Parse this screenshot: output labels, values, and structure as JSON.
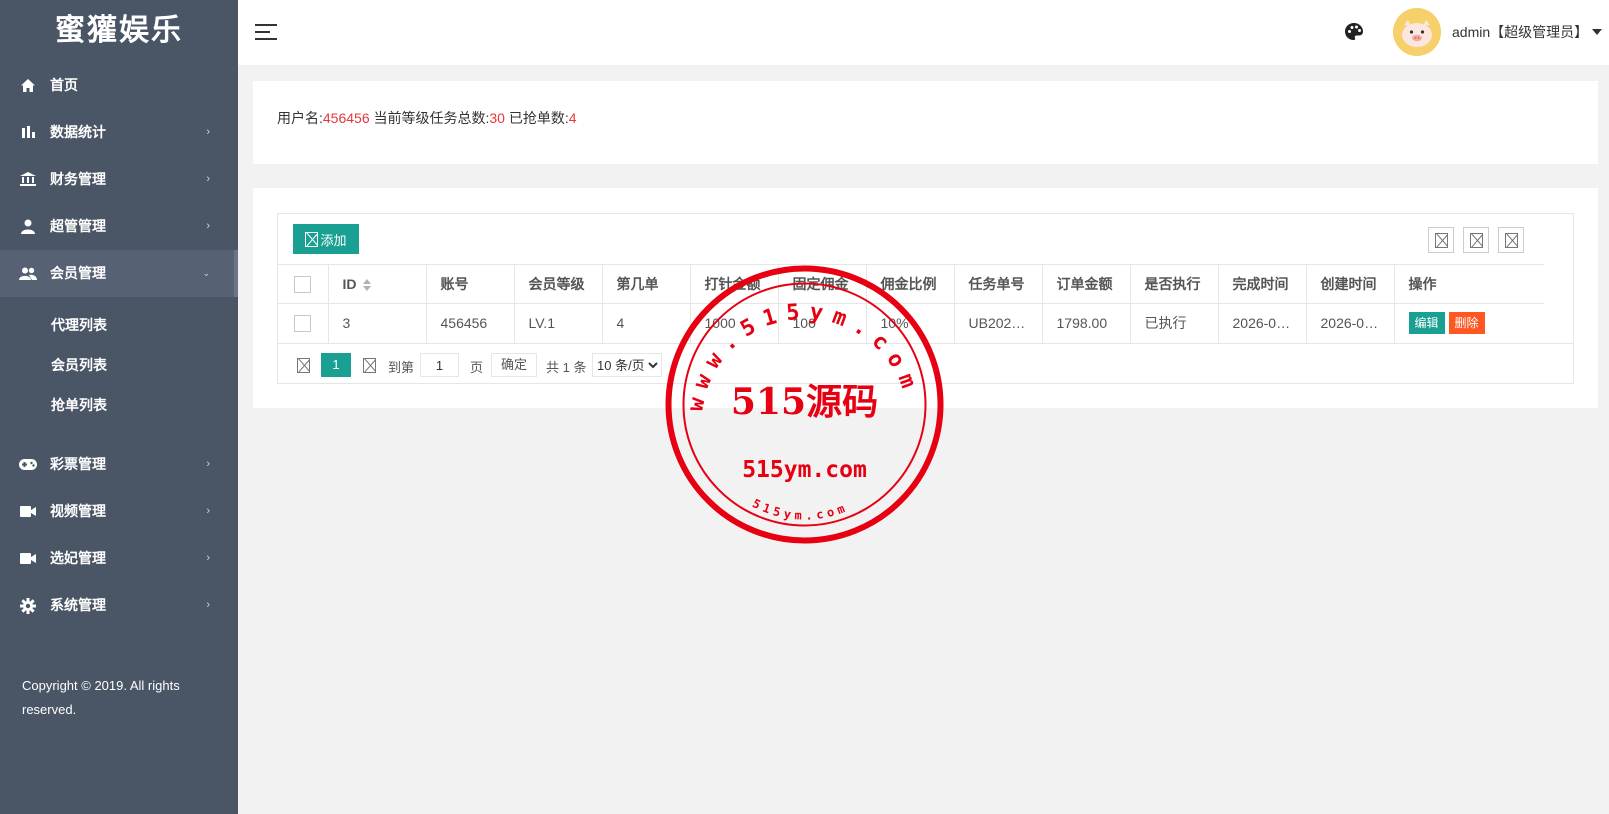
{
  "brand": "蜜獾娱乐",
  "sidebar": {
    "items": [
      {
        "label": "首页",
        "icon": "home-icon"
      },
      {
        "label": "数据统计",
        "icon": "bar-chart-icon"
      },
      {
        "label": "财务管理",
        "icon": "bank-icon"
      },
      {
        "label": "超管管理",
        "icon": "user-icon"
      },
      {
        "label": "会员管理",
        "icon": "users-icon"
      },
      {
        "label": "彩票管理",
        "icon": "gamepad-icon"
      },
      {
        "label": "视频管理",
        "icon": "video-icon"
      },
      {
        "label": "选妃管理",
        "icon": "video-icon"
      },
      {
        "label": "系统管理",
        "icon": "gear-icon"
      }
    ],
    "submenu": [
      "代理列表",
      "会员列表",
      "抢单列表"
    ],
    "copyright": "Copyright © 2019. All rights reserved."
  },
  "header": {
    "user": "admin【超级管理员】"
  },
  "info": {
    "username_label": "用户名:",
    "username": "456456",
    "total_label": " 当前等级任务总数:",
    "total": "30",
    "grabbed_label": " 已抢单数:",
    "grabbed": "4"
  },
  "toolbar": {
    "add_label": "添加"
  },
  "table": {
    "headers": [
      "ID",
      "账号",
      "会员等级",
      "第几单",
      "打针金额",
      "固定佣金",
      "佣金比例",
      "任务单号",
      "订单金额",
      "是否执行",
      "完成时间",
      "创建时间",
      "操作"
    ],
    "rows": [
      {
        "id": "3",
        "account": "456456",
        "level": "LV.1",
        "order_no": "4",
        "inject": "1000",
        "fixed": "100",
        "ratio": "10%",
        "task_no": "UB202…",
        "amount": "1798.00",
        "executed": "已执行",
        "finish_time": "2026-0…",
        "create_time": "2026-0…"
      }
    ],
    "edit_label": "编辑",
    "delete_label": "删除"
  },
  "pager": {
    "current": "1",
    "goto_label": "到第",
    "page_value": "1",
    "page_label": "页",
    "confirm_label": "确定",
    "total": "共 1 条",
    "per_page": "10 条/页"
  },
  "watermark": {
    "arc_text": "www.515ym.com",
    "center_text": "515源码",
    "domain_text": "515ym.com",
    "bottom_text": "515ym.com",
    "color": "#e60012"
  }
}
